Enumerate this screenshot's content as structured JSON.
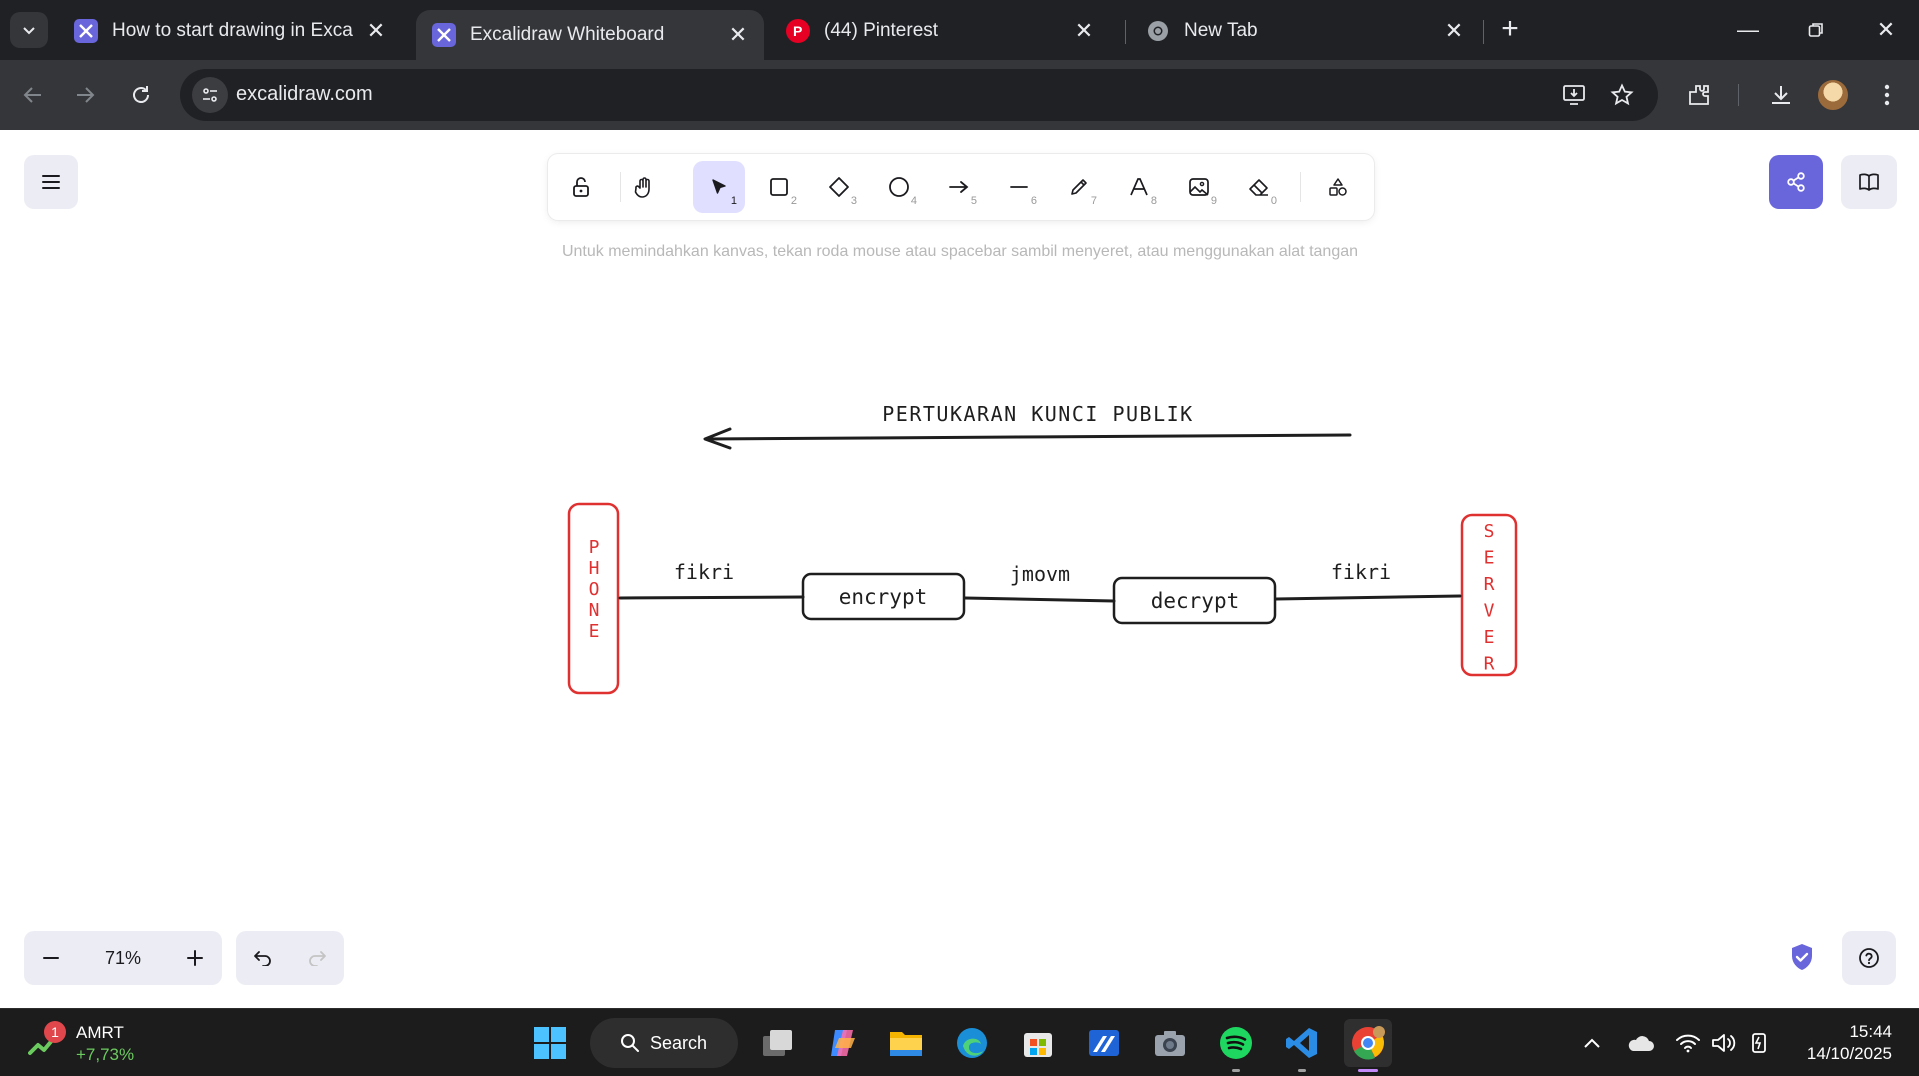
{
  "browser": {
    "tabs": [
      {
        "label": "How to start drawing in Excalidr",
        "active": false,
        "favicon": "excalidraw-icon"
      },
      {
        "label": "Excalidraw Whiteboard",
        "active": true,
        "favicon": "excalidraw-icon"
      },
      {
        "label": "(44) Pinterest",
        "active": false,
        "favicon": "pinterest-icon"
      },
      {
        "label": "New Tab",
        "active": false,
        "favicon": "chrome-icon"
      }
    ],
    "url": "excalidraw.com"
  },
  "excalidraw": {
    "toolbar_keys": [
      "1",
      "2",
      "3",
      "4",
      "5",
      "6",
      "7",
      "8",
      "9",
      "0"
    ],
    "hint": "Untuk memindahkan kanvas, tekan roda mouse atau spacebar sambil menyeret, atau menggunakan alat tangan",
    "zoom": "71%",
    "accent_color": "#6965db"
  },
  "drawing": {
    "arrow_label": "PERTUKARAN KUNCI PUBLIK",
    "phone_letters": [
      "P",
      "H",
      "O",
      "N",
      "E"
    ],
    "server_letters": [
      "S",
      "E",
      "R",
      "V",
      "E",
      "R"
    ],
    "encrypt_label": "encrypt",
    "decrypt_label": "decrypt",
    "plaintext_left": "fikri",
    "ciphertext": "jmovm",
    "plaintext_right": "fikri",
    "endpoint_color": "#e03131"
  },
  "taskbar": {
    "stock_badge": "1",
    "stock_ticker": "AMRT",
    "stock_change": "+7,73%",
    "search_label": "Search",
    "time": "15:44",
    "date": "14/10/2025"
  }
}
